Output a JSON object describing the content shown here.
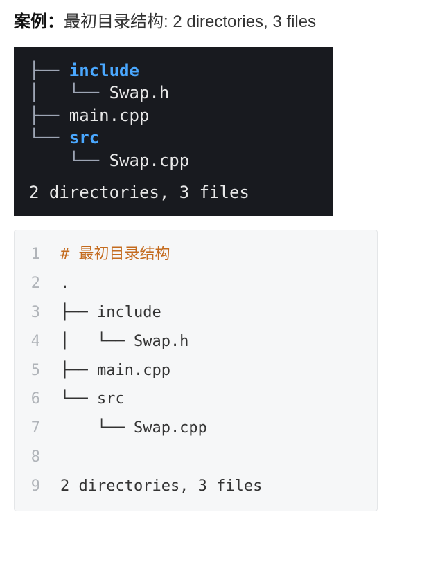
{
  "header": {
    "label": "案例：",
    "desc": "最初目录结构: 2 directories, 3 files"
  },
  "terminal": {
    "lines": [
      {
        "segments": [
          {
            "t": "├── ",
            "cls": "trm-grey"
          },
          {
            "t": "include",
            "cls": "trm-blue"
          }
        ]
      },
      {
        "segments": [
          {
            "t": "│   └── ",
            "cls": "trm-grey"
          },
          {
            "t": "Swap.h",
            "cls": "trm-white"
          }
        ]
      },
      {
        "segments": [
          {
            "t": "├── ",
            "cls": "trm-grey"
          },
          {
            "t": "main.cpp",
            "cls": "trm-white"
          }
        ]
      },
      {
        "segments": [
          {
            "t": "└── ",
            "cls": "trm-grey"
          },
          {
            "t": "src",
            "cls": "trm-blue"
          }
        ]
      },
      {
        "segments": [
          {
            "t": "    └── ",
            "cls": "trm-grey"
          },
          {
            "t": "Swap.cpp",
            "cls": "trm-white"
          }
        ]
      }
    ],
    "summary": "2 directories, 3 files"
  },
  "codeblock": {
    "lines": [
      {
        "n": "1",
        "segments": [
          {
            "t": "# ",
            "cls": "comment-hash"
          },
          {
            "t": "最初目录结构",
            "cls": "comment-text"
          }
        ]
      },
      {
        "n": "2",
        "segments": [
          {
            "t": ".",
            "cls": ""
          }
        ]
      },
      {
        "n": "3",
        "segments": [
          {
            "t": "├── include",
            "cls": ""
          }
        ]
      },
      {
        "n": "4",
        "segments": [
          {
            "t": "│   └── Swap.h",
            "cls": ""
          }
        ]
      },
      {
        "n": "5",
        "segments": [
          {
            "t": "├── main.cpp",
            "cls": ""
          }
        ]
      },
      {
        "n": "6",
        "segments": [
          {
            "t": "└── src",
            "cls": ""
          }
        ]
      },
      {
        "n": "7",
        "segments": [
          {
            "t": "    └── Swap.cpp",
            "cls": ""
          }
        ]
      },
      {
        "n": "8",
        "segments": [
          {
            "t": "",
            "cls": ""
          }
        ]
      },
      {
        "n": "9",
        "segments": [
          {
            "t": "2 directories, 3 files",
            "cls": ""
          }
        ]
      }
    ]
  }
}
